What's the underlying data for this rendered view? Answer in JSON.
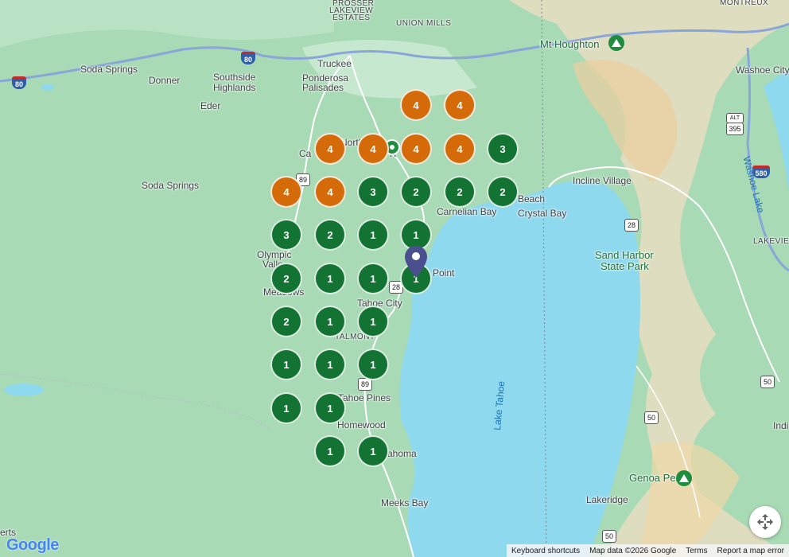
{
  "places": [
    {
      "id": "prosser",
      "label": "PROSSER"
    },
    {
      "id": "lakeview-estates-1",
      "label": "LAKEVIEW"
    },
    {
      "id": "lakeview-estates-2",
      "label": "ESTATES"
    },
    {
      "id": "union-mills",
      "label": "UNION MILLS"
    },
    {
      "id": "montreux",
      "label": "MONTREUX"
    },
    {
      "id": "mt-houghton",
      "label": "Mt Houghton"
    },
    {
      "id": "washoe-city",
      "label": "Washoe City"
    },
    {
      "id": "soda-springs-n",
      "label": "Soda Springs"
    },
    {
      "id": "donner",
      "label": "Donner"
    },
    {
      "id": "southside-1",
      "label": "Southside"
    },
    {
      "id": "southside-2",
      "label": "Highlands"
    },
    {
      "id": "truckee",
      "label": "Truckee"
    },
    {
      "id": "ponderosa-1",
      "label": "Ponderosa"
    },
    {
      "id": "ponderosa-2",
      "label": "Palisades"
    },
    {
      "id": "eder",
      "label": "Eder"
    },
    {
      "id": "washoe-lake",
      "label": "Washoe Lake"
    },
    {
      "id": "northstar-1",
      "label": "North"
    },
    {
      "id": "northstar-2",
      "label": "Ca"
    },
    {
      "id": "northstar-3",
      "label": "R"
    },
    {
      "id": "soda-springs-s",
      "label": "Soda Springs"
    },
    {
      "id": "incline-village",
      "label": "Incline Village"
    },
    {
      "id": "beach",
      "label": "Beach"
    },
    {
      "id": "carnelian-bay",
      "label": "Carnelian Bay"
    },
    {
      "id": "crystal-bay",
      "label": "Crystal Bay"
    },
    {
      "id": "olympic-valley-1",
      "label": "Olympic"
    },
    {
      "id": "olympic-valley-2",
      "label": "Valle"
    },
    {
      "id": "sand-harbor-1",
      "label": "Sand Harbor"
    },
    {
      "id": "sand-harbor-2",
      "label": "State Park"
    },
    {
      "id": "lakeview",
      "label": "LAKEVIEW"
    },
    {
      "id": "point",
      "label": "Point"
    },
    {
      "id": "meadows",
      "label": "Meadows"
    },
    {
      "id": "tahoe-city",
      "label": "Tahoe City"
    },
    {
      "id": "talmont",
      "label": "TALMONT"
    },
    {
      "id": "tahoe-pines",
      "label": "Tahoe Pines"
    },
    {
      "id": "homewood",
      "label": "Homewood"
    },
    {
      "id": "tahoma",
      "label": "ahoma"
    },
    {
      "id": "meeks-bay",
      "label": "Meeks Bay"
    },
    {
      "id": "lakeridge",
      "label": "Lakeridge"
    },
    {
      "id": "genoa-peak",
      "label": "Genoa Peak"
    },
    {
      "id": "indi",
      "label": "Indi"
    },
    {
      "id": "erts",
      "label": "erts"
    },
    {
      "id": "lake-tahoe",
      "label": "Lake Tahoe"
    }
  ],
  "highway_shields": [
    {
      "id": "i80-west",
      "label": "80"
    },
    {
      "id": "i80-east",
      "label": "80"
    },
    {
      "id": "i580",
      "label": "580"
    },
    {
      "id": "alt395",
      "label": "395"
    },
    {
      "id": "alt",
      "label": "ALT"
    },
    {
      "id": "sr89-north",
      "label": "89"
    },
    {
      "id": "sr28-west",
      "label": "28"
    },
    {
      "id": "sr28-east",
      "label": "28"
    },
    {
      "id": "sr89-south",
      "label": "89"
    },
    {
      "id": "us50-a",
      "label": "50"
    },
    {
      "id": "us50-b",
      "label": "50"
    },
    {
      "id": "us50-c",
      "label": "50"
    }
  ],
  "clusters": [
    {
      "count": "4",
      "type": "orange"
    },
    {
      "count": "4",
      "type": "orange"
    },
    {
      "count": "4",
      "type": "orange"
    },
    {
      "count": "4",
      "type": "orange"
    },
    {
      "count": "4",
      "type": "orange"
    },
    {
      "count": "4",
      "type": "orange"
    },
    {
      "count": "3",
      "type": "green"
    },
    {
      "count": "4",
      "type": "orange"
    },
    {
      "count": "4",
      "type": "orange"
    },
    {
      "count": "3",
      "type": "green"
    },
    {
      "count": "2",
      "type": "green"
    },
    {
      "count": "2",
      "type": "green"
    },
    {
      "count": "2",
      "type": "green"
    },
    {
      "count": "3",
      "type": "green"
    },
    {
      "count": "2",
      "type": "green"
    },
    {
      "count": "1",
      "type": "green"
    },
    {
      "count": "1",
      "type": "green"
    },
    {
      "count": "2",
      "type": "green"
    },
    {
      "count": "1",
      "type": "green"
    },
    {
      "count": "1",
      "type": "green"
    },
    {
      "count": "1",
      "type": "green"
    },
    {
      "count": "2",
      "type": "green"
    },
    {
      "count": "1",
      "type": "green"
    },
    {
      "count": "1",
      "type": "green"
    },
    {
      "count": "1",
      "type": "green"
    },
    {
      "count": "1",
      "type": "green"
    },
    {
      "count": "1",
      "type": "green"
    },
    {
      "count": "1",
      "type": "green"
    },
    {
      "count": "1",
      "type": "green"
    },
    {
      "count": "1",
      "type": "green"
    },
    {
      "count": "1",
      "type": "green"
    }
  ],
  "colors": {
    "orange_cluster": "#d46b08",
    "green_cluster": "#137333",
    "water": "#8fd9ef",
    "land": "#a8dab5",
    "forest": "#94d2a5",
    "desert": "#f2dfc4",
    "pin": "#4b4f8f"
  },
  "attribution": {
    "keyboard": "Keyboard shortcuts",
    "mapdata": "Map data ©2026 Google",
    "terms": "Terms",
    "report": "Report a map error"
  },
  "logo": "Google"
}
